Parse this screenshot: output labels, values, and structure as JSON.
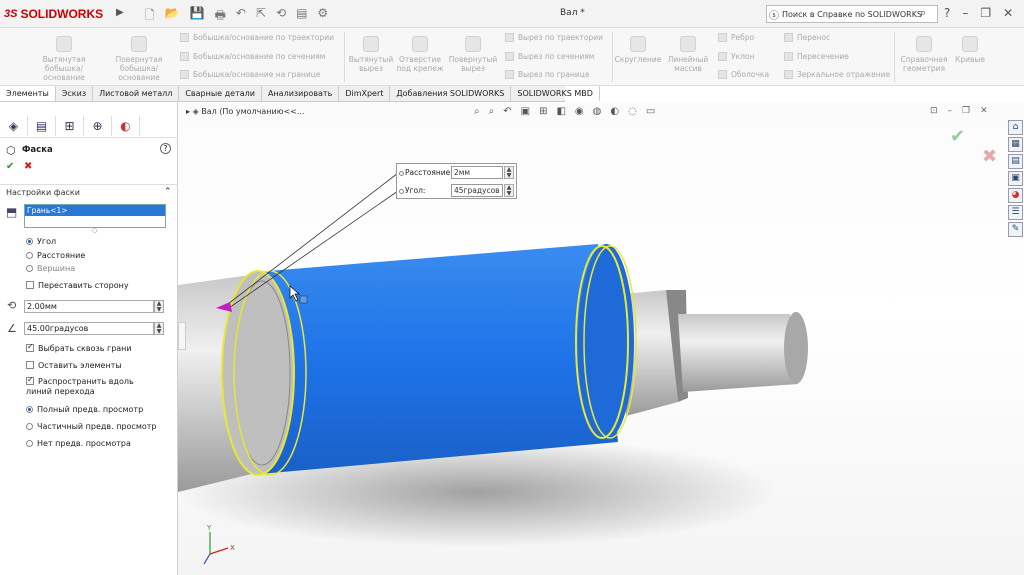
{
  "app": {
    "logo_ds": "3S",
    "logo_name": "SOLIDWORKS",
    "doc_title": "Вал *"
  },
  "help": {
    "search_placeholder": "Поиск в Справке по SOLIDWORKS"
  },
  "ribbon": {
    "big_left": [
      {
        "label": "Вытянутая бобышка/основание"
      },
      {
        "label": "Повернутая бобышка/основание"
      }
    ],
    "rows_left": [
      "Бобышка/основание по траектории",
      "Бобышка/основание по сечениям",
      "Бобышка/основание на границе"
    ],
    "big_mid": [
      {
        "label": "Вытянутый вырез"
      },
      {
        "label": "Отверстие под крепеж"
      },
      {
        "label": "Повернутый вырез"
      }
    ],
    "rows_mid": [
      "Вырез по траектории",
      "Вырез по сечениям",
      "Вырез по границе"
    ],
    "big_right": [
      {
        "label": "Скругление"
      },
      {
        "label": "Линейный массив"
      }
    ],
    "rows_right1": [
      "Ребро",
      "Уклон",
      "Оболочка"
    ],
    "rows_right2": [
      "Перенос",
      "Пересечение",
      "Зеркальное отражение"
    ],
    "big_far": [
      {
        "label": "Справочная геометрия"
      },
      {
        "label": "Кривые"
      }
    ]
  },
  "tabs": [
    "Элементы",
    "Эскиз",
    "Листовой металл",
    "Сварные детали",
    "Анализировать",
    "DimXpert",
    "Добавления SOLIDWORKS",
    "SOLIDWORKS MBD"
  ],
  "panel": {
    "title": "Фаска",
    "section": "Настройки фаски",
    "selection": "Грань<1>",
    "radio_types": [
      {
        "label": "Угол",
        "on": true
      },
      {
        "label": "Расстояние",
        "on": false
      },
      {
        "label": "Вершина",
        "on": false
      }
    ],
    "flip_label": "Переставить сторону",
    "distance_value": "2.00мм",
    "angle_value": "45.00градусов",
    "checks": [
      {
        "label": "Выбрать сквозь грани",
        "on": true
      },
      {
        "label": "Оставить элементы",
        "on": false
      },
      {
        "label": "Распространить вдоль линий перехода",
        "on": true
      }
    ],
    "preview": [
      {
        "label": "Полный предв. просмотр",
        "on": true
      },
      {
        "label": "Частичный предв. просмотр",
        "on": false
      },
      {
        "label": "Нет предв. просмотра",
        "on": false
      }
    ]
  },
  "viewport": {
    "breadcrumb": "Вал  (По умолчанию<<...",
    "dim_distance_label": "Расстояние:",
    "dim_distance_value": "2мм",
    "dim_angle_label": "Угол:",
    "dim_angle_value": "45градусов",
    "triad_x": "X",
    "triad_y": "Y"
  },
  "colors": {
    "face_selected": "#1e73e8",
    "edge_highlight": "#e8e834",
    "accent": "#cc0000"
  }
}
